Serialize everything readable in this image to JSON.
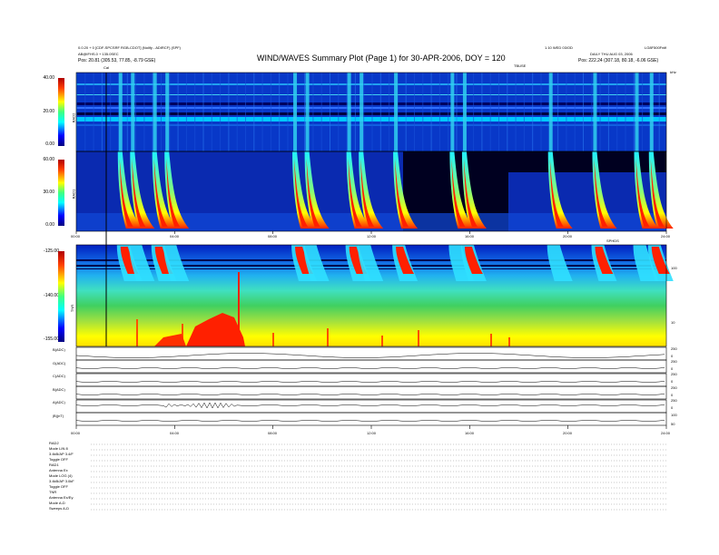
{
  "header": {
    "top_left_1": "0.0.20 + 0 [CDF-SPCSRF RGB-CDOT] (Nolify - ADIRCF) (SPF)",
    "top_left_2": "AB@IFHS.0 + 135.0SEC",
    "top_left_3": "Pos:   20.81 (305.53, 77.85, -8.79 GSE)",
    "title": "WIND/WAVES Summary Plot (Page 1) for 30-APR-2006, DOY = 120",
    "top_right_1": "1.10 WED 03/OD",
    "top_right_2": "LG8F500Fnifi",
    "top_right_3": "DAILY  THU AUG 03, 2006",
    "top_right_4": "Pos:   222.24 (307.18, 80.18, -6.06 GSE)",
    "cal_label": "Cal",
    "tbuse_label": "TBUSE",
    "khz_label": "kHz"
  },
  "panels": [
    {
      "name": "RAD2",
      "ticks": [
        "40.00",
        "20.00",
        "0.00"
      ]
    },
    {
      "name": "RAD1",
      "ticks": [
        "60.00",
        "30.00",
        "0.00"
      ]
    },
    {
      "name": "TNR",
      "ticks": [
        "-125.00",
        "-140.00",
        "-155.00"
      ]
    }
  ],
  "right_axis": {
    "ticks": [
      "100",
      "10"
    ]
  },
  "time_axis_1": [
    "00:00",
    "04:00",
    "08:00",
    "12:00",
    "16:00",
    "20:00",
    "24:00"
  ],
  "time_axis_2": [
    "00:00",
    "04:00",
    "08:00",
    "12:00",
    "16:00",
    "20:00",
    "24:00"
  ],
  "spectra_label": "SPHDS",
  "line_panels": [
    {
      "name": "B(ADC)",
      "right": [
        "250",
        "0"
      ]
    },
    {
      "name": "G(ADC)",
      "right": [
        "250",
        "0"
      ]
    },
    {
      "name": "C(ADC)",
      "right": [
        "250",
        "0"
      ]
    },
    {
      "name": "B(ADC)",
      "right": [
        "250",
        "0"
      ]
    },
    {
      "name": "A(ADC)",
      "right": [
        "250",
        "0"
      ]
    },
    {
      "name": "|B|(nT)",
      "right": [
        "100",
        "50"
      ]
    }
  ],
  "footer_rows": [
    "RAD2",
    "Mode    LIN 8",
    "3.4kB/AP  3.4/F",
    "Toggle    OFF",
    "RAD1",
    "Antenna    Ex",
    "Mode    LOG (4)",
    "3.4kB/AP 3.0kF",
    "Toggle    OFF",
    "TNR",
    "Antenna   Ex/Ey",
    "Mode      A-D",
    "Sweeps    A-D"
  ],
  "colors": {
    "bg": "#0018a8",
    "radio": "#ff2000",
    "yellow": "#ffff00",
    "green": "#00d060",
    "cyan": "#30d0f0"
  },
  "chart_data": {
    "type": "heatmap",
    "title": "WIND/WAVES Summary Plot (Page 1) for 30-APR-2006, DOY = 120",
    "xlabel": "",
    "x_ticks": [
      "00:00",
      "04:00",
      "08:00",
      "12:00",
      "16:00",
      "20:00",
      "24:00"
    ],
    "xlim_hours": [
      0,
      24
    ],
    "panels": [
      {
        "name": "RAD2",
        "ylim": [
          0,
          40
        ]
      },
      {
        "name": "RAD1",
        "ylim": [
          0,
          60
        ]
      },
      {
        "name": "TNR",
        "ylim": [
          -155,
          -125
        ]
      }
    ],
    "burst_times_hours": [
      1.8,
      2.3,
      3.2,
      3.7,
      8.9,
      9.4,
      11.1,
      11.6,
      13.0,
      15.3,
      15.8,
      19.3,
      21.1,
      22.8,
      23.4
    ]
  }
}
